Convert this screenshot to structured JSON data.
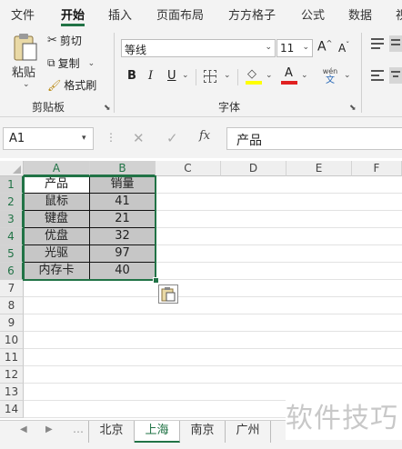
{
  "ribbon_tabs": [
    "文件",
    "开始",
    "插入",
    "页面布局",
    "方方格子",
    "公式",
    "数据",
    "视"
  ],
  "clipboard": {
    "paste_label": "粘贴",
    "cut_label": "剪切",
    "copy_label": "复制",
    "format_painter_label": "格式刷",
    "group_label": "剪贴板"
  },
  "font": {
    "name": "等线",
    "size": "11",
    "grow_label": "A",
    "shrink_label": "A",
    "bold_label": "B",
    "italic_label": "I",
    "underline_label": "U",
    "color_label": "A",
    "phonetic_top": "wén",
    "phonetic_bottom": "文",
    "group_label": "字体"
  },
  "formula_bar": {
    "name_box": "A1",
    "fx_label": "fx",
    "value": "产品"
  },
  "columns": [
    "A",
    "B",
    "C",
    "D",
    "E",
    "F"
  ],
  "rows": [
    "1",
    "2",
    "3",
    "4",
    "5",
    "6",
    "7",
    "8",
    "9",
    "10",
    "11",
    "12",
    "13",
    "14"
  ],
  "table": {
    "headers": [
      "产品",
      "销量"
    ],
    "data": [
      [
        "鼠标",
        "41"
      ],
      [
        "键盘",
        "21"
      ],
      [
        "优盘",
        "32"
      ],
      [
        "光驱",
        "97"
      ],
      [
        "内存卡",
        "40"
      ]
    ]
  },
  "sheet_tabs": [
    "北京",
    "上海",
    "南京",
    "广州"
  ],
  "active_sheet": "上海",
  "watermark": "软件技巧",
  "colors": {
    "accent": "#217346",
    "selection": "#c6c6c6"
  }
}
